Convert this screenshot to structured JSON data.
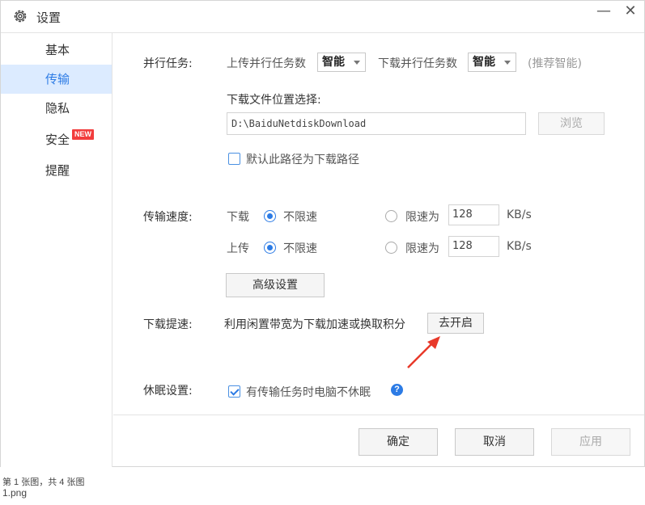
{
  "window": {
    "title": "设置",
    "minimize": "—",
    "close": "✕"
  },
  "sidebar": {
    "items": [
      {
        "label": "基本"
      },
      {
        "label": "传输"
      },
      {
        "label": "隐私"
      },
      {
        "label": "安全",
        "badge": "NEW"
      },
      {
        "label": "提醒"
      }
    ],
    "active_index": 1
  },
  "parallel": {
    "label": "并行任务:",
    "upload_label": "上传并行任务数",
    "upload_value": "智能",
    "download_label": "下载并行任务数",
    "download_value": "智能",
    "hint": "(推荐智能)"
  },
  "download_location": {
    "label": "下载文件位置选择:",
    "path": "D:\\BaiduNetdiskDownload",
    "browse": "浏览",
    "default_checkbox": "默认此路径为下载路径",
    "default_checked": false
  },
  "speed": {
    "label": "传输速度:",
    "download": {
      "label": "下载",
      "unlimited": "不限速",
      "limit": "限速为",
      "value": "128",
      "unit": "KB/s"
    },
    "upload": {
      "label": "上传",
      "unlimited": "不限速",
      "limit": "限速为",
      "value": "128",
      "unit": "KB/s"
    },
    "advanced": "高级设置"
  },
  "boost": {
    "label": "下载提速:",
    "desc": "利用闲置带宽为下载加速或换取积分",
    "button": "去开启"
  },
  "sleep": {
    "label": "休眠设置:",
    "checkbox": "有传输任务时电脑不休眠",
    "checked": true,
    "help": "?"
  },
  "footer": {
    "ok": "确定",
    "cancel": "取消",
    "apply": "应用"
  },
  "caption": {
    "line1": "第 1 张图，共 4 张图",
    "line2": "1.png"
  },
  "colors": {
    "accent": "#2c7be5",
    "annotation_arrow": "#e8392a",
    "active_bg": "#dcebff"
  }
}
